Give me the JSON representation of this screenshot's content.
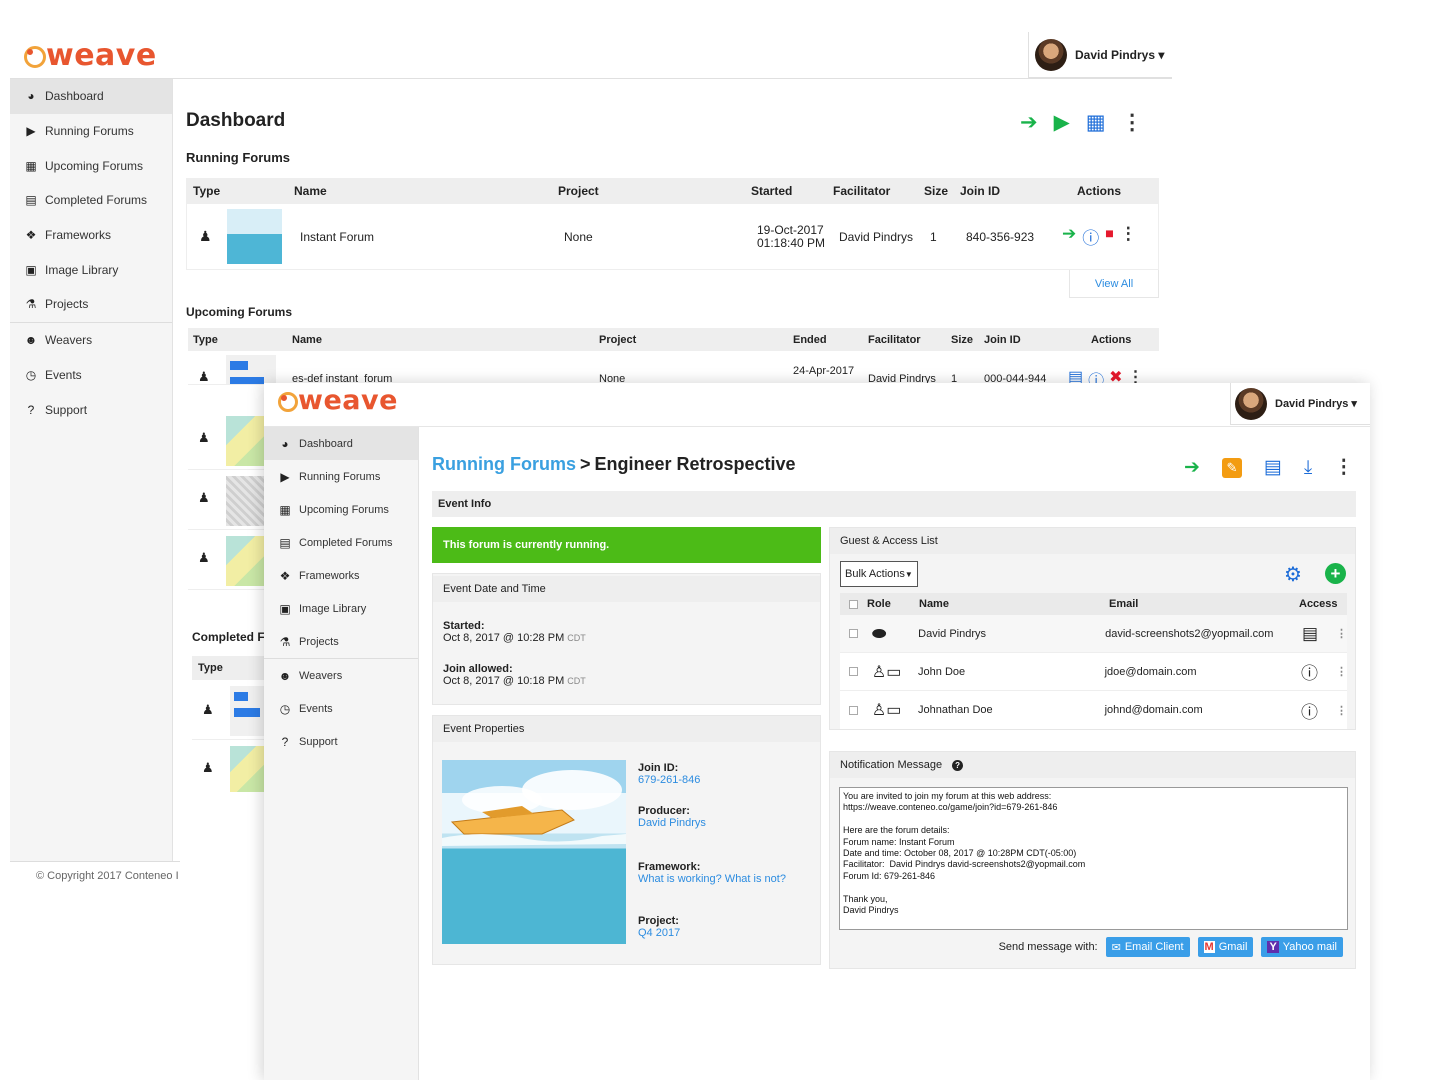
{
  "brand": {
    "logo_text": "weave"
  },
  "user": {
    "name": "David Pindrys ▾"
  },
  "back": {
    "sidebar": [
      {
        "label": "Dashboard",
        "icon": "tachometer-icon",
        "glyph": "◕"
      },
      {
        "label": "Running Forums",
        "icon": "play-circle-icon",
        "glyph": "▶"
      },
      {
        "label": "Upcoming Forums",
        "icon": "calendar-icon",
        "glyph": "▦"
      },
      {
        "label": "Completed Forums",
        "icon": "file-icon",
        "glyph": "▤"
      },
      {
        "label": "Frameworks",
        "icon": "cubes-icon",
        "glyph": "❖"
      },
      {
        "label": "Image Library",
        "icon": "image-icon",
        "glyph": "▣"
      },
      {
        "label": "Projects",
        "icon": "flask-icon",
        "glyph": "⚗"
      },
      {
        "label": "Weavers",
        "icon": "users-icon",
        "glyph": "☻"
      },
      {
        "label": "Events",
        "icon": "clock-icon",
        "glyph": "◷"
      },
      {
        "label": "Support",
        "icon": "question-circle-icon",
        "glyph": "?"
      }
    ],
    "page_title": "Dashboard",
    "copyright": "© Copyright 2017 Conteneo I",
    "running": {
      "title": "Running Forums",
      "headers": [
        "Type",
        "Name",
        "Project",
        "Started",
        "Facilitator",
        "Size",
        "Join ID",
        "Actions"
      ],
      "rows": [
        {
          "name": "Instant Forum",
          "project": "None",
          "started_date": "19-Oct-2017",
          "started_time": "01:18:40 PM",
          "facilitator": "David Pindrys",
          "size": "1",
          "join_id": "840-356-923"
        }
      ],
      "view_all": "View All"
    },
    "upcoming": {
      "title": "Upcoming Forums",
      "headers": [
        "Type",
        "Name",
        "Project",
        "Ended",
        "Facilitator",
        "Size",
        "Join ID",
        "Actions"
      ],
      "row": {
        "name": "es-def instant_forum",
        "project": "None",
        "ended": "24-Apr-2017",
        "facilitator": "David Pindrys",
        "size": "1",
        "join_id": "000-044-944"
      }
    },
    "completed": {
      "title": "Completed F",
      "type_header": "Type"
    }
  },
  "front": {
    "sidebar": [
      {
        "label": "Dashboard",
        "icon": "tachometer-icon",
        "glyph": "◕"
      },
      {
        "label": "Running Forums",
        "icon": "play-circle-icon",
        "glyph": "▶"
      },
      {
        "label": "Upcoming Forums",
        "icon": "calendar-icon",
        "glyph": "▦"
      },
      {
        "label": "Completed Forums",
        "icon": "file-icon",
        "glyph": "▤"
      },
      {
        "label": "Frameworks",
        "icon": "cubes-icon",
        "glyph": "❖"
      },
      {
        "label": "Image Library",
        "icon": "image-icon",
        "glyph": "▣"
      },
      {
        "label": "Projects",
        "icon": "flask-icon",
        "glyph": "⚗"
      },
      {
        "label": "Weavers",
        "icon": "users-icon",
        "glyph": "☻"
      },
      {
        "label": "Events",
        "icon": "clock-icon",
        "glyph": "◷"
      },
      {
        "label": "Support",
        "icon": "question-circle-icon",
        "glyph": "?"
      }
    ],
    "breadcrumb": {
      "parent": "Running Forums",
      "sep": ">",
      "current": "Engineer Retrospective"
    },
    "event_info": "Event Info",
    "running_banner": "This forum is currently running.",
    "date_time": {
      "title": "Event Date and Time",
      "started_label": "Started:",
      "started_value": "Oct 8, 2017 @ 10:28 PM",
      "started_tz": "CDT",
      "join_label": "Join allowed:",
      "join_value": "Oct 8, 2017 @ 10:18 PM",
      "join_tz": "CDT"
    },
    "properties": {
      "title": "Event Properties",
      "join_id_label": "Join ID:",
      "join_id": "679-261-846",
      "producer_label": "Producer:",
      "producer": "David Pindrys",
      "framework_label": "Framework:",
      "framework": "What is working? What is not?",
      "project_label": "Project:",
      "project": "Q4 2017"
    },
    "guest": {
      "title": "Guest & Access List",
      "bulk_actions": "Bulk Actions",
      "headers": {
        "role": "Role",
        "name": "Name",
        "email": "Email",
        "access": "Access"
      },
      "rows": [
        {
          "name": "David Pindrys",
          "email": "david-screenshots2@yopmail.com",
          "role_icon": "producer-hat-icon",
          "access_icon": "document-icon"
        },
        {
          "name": "John Doe",
          "email": "jdoe@domain.com",
          "role_icon": "user-card-icon",
          "access_icon": "info-circle-icon"
        },
        {
          "name": "Johnathan Doe",
          "email": "johnd@domain.com",
          "role_icon": "user-card-icon",
          "access_icon": "info-circle-icon"
        }
      ]
    },
    "notification": {
      "title": "Notification Message",
      "message": "You are invited to join my forum at this web address:\nhttps://weave.conteneo.co/game/join?id=679-261-846\n\nHere are the forum details:\nForum name: Instant Forum\nDate and time: October 08, 2017 @ 10:28PM CDT(-05:00)\nFacilitator:  David Pindrys david-screenshots2@yopmail.com\nForum Id: 679-261-846\n\nThank you,\nDavid Pindrys",
      "send_label": "Send message with:",
      "email_client": "Email Client",
      "gmail": "Gmail",
      "yahoo": "Yahoo mail"
    }
  },
  "colors": {
    "brand": "#e8562f",
    "green": "#19b34a",
    "blue": "#1c6cd8",
    "banner": "#4cbb17",
    "link": "#2c8ce0"
  }
}
